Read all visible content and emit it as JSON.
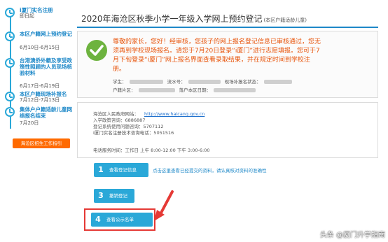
{
  "sidebar": {
    "items": [
      {
        "title": "i厦门实名注册",
        "date": "即日起"
      },
      {
        "title": "本区户籍网上预约登记",
        "date": "6月10日-6月15日"
      },
      {
        "title": "台港澳侨外籍及享受政策性照顾的人员现场核验材料",
        "date": "6月17日-6月19日"
      },
      {
        "title": "本区户籍现场补报名",
        "date": "7月12日-7月13日"
      },
      {
        "title": "集体户户籍适龄儿童网络报名结束",
        "date": "7月20日"
      }
    ],
    "guide_button": "海沧区招生工作指引"
  },
  "header": {
    "title": "2020年海沧区秋季小学一年级入学网上预约登记",
    "subtitle": "(本区户籍适龄儿童)"
  },
  "notice": {
    "lines": [
      "尊敬的家长，您好！经审核，您孩子的网上报名登记信息已审核通过，您无",
      "须再到学校现场报名。请您于7月20日登录“i厦门”进行志愿填报。您可于7",
      "月下旬登录“i厦门”网上报名界面查看录取结果，并在规定时间到学校注",
      "册。"
    ],
    "student_label": "学生：",
    "serial_label": "流水号：",
    "onsite_label": "现场补报名状态：",
    "household_label": "户籍片区：",
    "hukou_date_label": "落户本区日期："
  },
  "contact": {
    "site_label": "海沧区人民政府网站：",
    "site_url": "http://www.haicang.gov.cn",
    "enroll_phone": "入学政策咨询：6886887",
    "system_phone": "登记系统使用问题咨询：5707112",
    "imx_phone": "i厦门实名注册技术咨询电话：5051516",
    "hours": "电话服务时间：工作日 上午 8:00-12:00 下午 3:00-6:00"
  },
  "steps": [
    {
      "num": "1",
      "label": "查看登记信息"
    },
    {
      "num": "3",
      "label": "撤销登记"
    },
    {
      "num": "4",
      "label": "查看公示名单"
    }
  ],
  "step_hint": "点击这里查看已经提交的资料，请认真核对资料的准确性",
  "watermark": "头条 @厦门升学指南",
  "colors": {
    "accent": "#2aa8d8",
    "notice_text": "#e8550c",
    "guide_button": "#ff6a00",
    "highlight": "#e53935",
    "check": "#6db33f"
  }
}
